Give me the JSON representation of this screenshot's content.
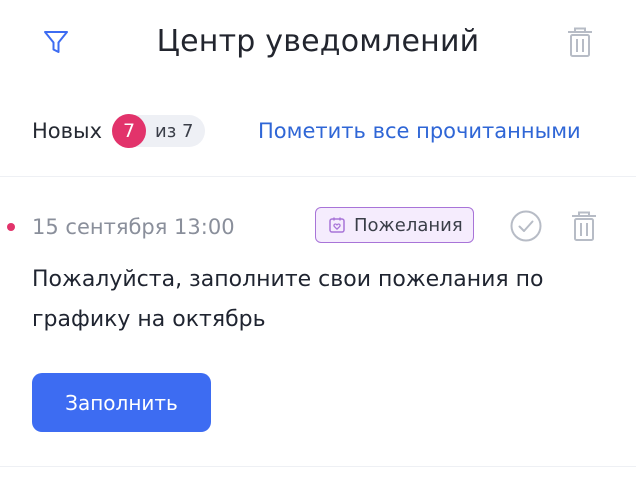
{
  "header": {
    "title": "Центр уведомлений",
    "filter_icon": "filter-icon",
    "delete_icon": "trash-icon"
  },
  "counter": {
    "new_label": "Новых",
    "unread_count": "7",
    "total_label": "из 7",
    "mark_all_label": "Пометить все прочитанными"
  },
  "notification": {
    "unread": true,
    "date": "15 сентября 13:00",
    "tag_label": "Пожелания",
    "tag_icon": "calendar-heart-icon",
    "message": "Пожалуйста, заполните свои пожелания по графику на октябрь",
    "action_label": "Заполнить",
    "read_icon": "check-circle-icon",
    "delete_icon": "trash-icon"
  },
  "colors": {
    "accent_blue": "#3d6cf2",
    "link_blue": "#2f66d6",
    "badge_pink": "#e2336b",
    "tag_border": "#a874d8",
    "tag_background": "#f5ecfd",
    "icon_gray": "#b7bcc6"
  }
}
